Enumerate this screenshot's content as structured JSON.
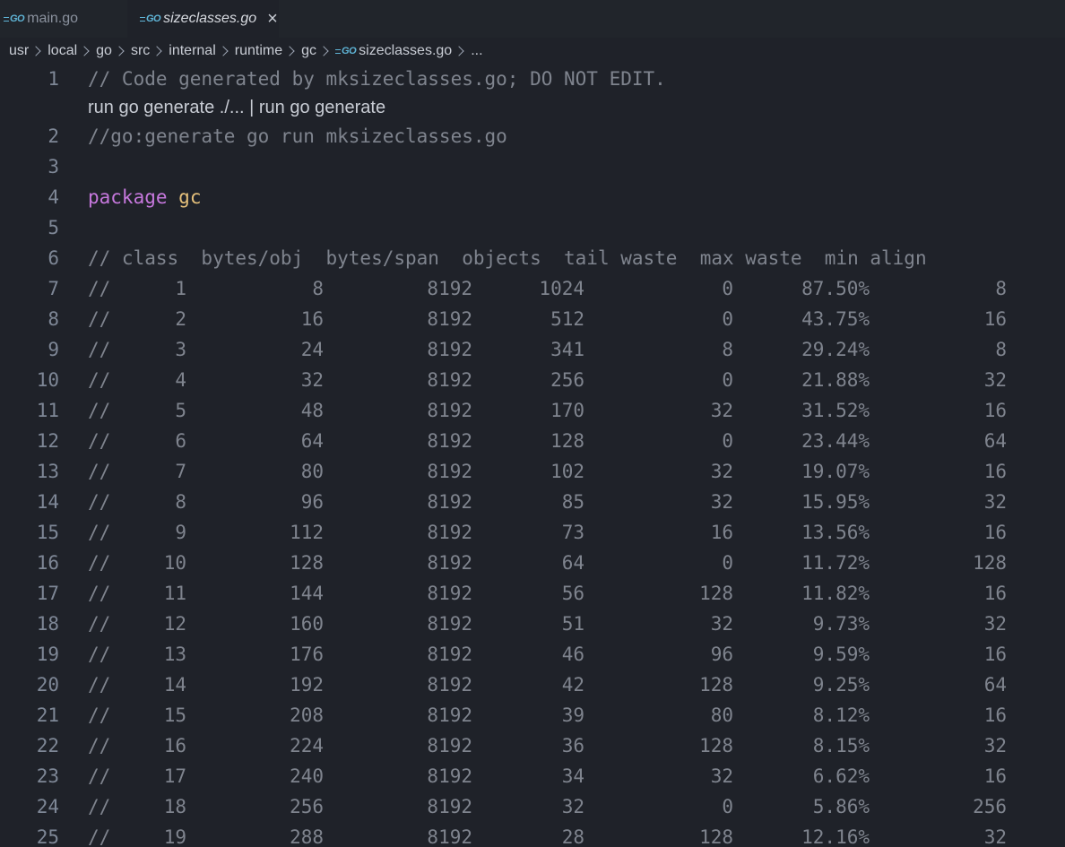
{
  "tabs": [
    {
      "name": "main.go",
      "logo": "GO",
      "active": false
    },
    {
      "name": "sizeclasses.go",
      "logo": "GO",
      "active": true
    }
  ],
  "breadcrumb": {
    "parts": [
      "usr",
      "local",
      "go",
      "src",
      "internal",
      "runtime",
      "gc"
    ],
    "file": "sizeclasses.go",
    "logo": "GO",
    "more": "..."
  },
  "editor": {
    "line1": {
      "num": "1",
      "text": "// Code generated by mksizeclasses.go; DO NOT EDIT."
    },
    "codelens": "run go generate ./... | run go generate",
    "line2": {
      "num": "2",
      "text": "//go:generate go run mksizeclasses.go"
    },
    "line3": {
      "num": "3"
    },
    "line4": {
      "num": "4",
      "keyword": "package",
      "name": "gc"
    },
    "line5": {
      "num": "5"
    },
    "line6": {
      "num": "6",
      "text": "// class  bytes/obj  bytes/span  objects  tail waste  max waste  min align"
    },
    "table_rows": [
      {
        "num": "7",
        "class": "1",
        "bytes_obj": "8",
        "bytes_span": "8192",
        "objects": "1024",
        "tail_waste": "0",
        "max_waste": "87.50%",
        "min_align": "8"
      },
      {
        "num": "8",
        "class": "2",
        "bytes_obj": "16",
        "bytes_span": "8192",
        "objects": "512",
        "tail_waste": "0",
        "max_waste": "43.75%",
        "min_align": "16"
      },
      {
        "num": "9",
        "class": "3",
        "bytes_obj": "24",
        "bytes_span": "8192",
        "objects": "341",
        "tail_waste": "8",
        "max_waste": "29.24%",
        "min_align": "8"
      },
      {
        "num": "10",
        "class": "4",
        "bytes_obj": "32",
        "bytes_span": "8192",
        "objects": "256",
        "tail_waste": "0",
        "max_waste": "21.88%",
        "min_align": "32"
      },
      {
        "num": "11",
        "class": "5",
        "bytes_obj": "48",
        "bytes_span": "8192",
        "objects": "170",
        "tail_waste": "32",
        "max_waste": "31.52%",
        "min_align": "16"
      },
      {
        "num": "12",
        "class": "6",
        "bytes_obj": "64",
        "bytes_span": "8192",
        "objects": "128",
        "tail_waste": "0",
        "max_waste": "23.44%",
        "min_align": "64"
      },
      {
        "num": "13",
        "class": "7",
        "bytes_obj": "80",
        "bytes_span": "8192",
        "objects": "102",
        "tail_waste": "32",
        "max_waste": "19.07%",
        "min_align": "16"
      },
      {
        "num": "14",
        "class": "8",
        "bytes_obj": "96",
        "bytes_span": "8192",
        "objects": "85",
        "tail_waste": "32",
        "max_waste": "15.95%",
        "min_align": "32"
      },
      {
        "num": "15",
        "class": "9",
        "bytes_obj": "112",
        "bytes_span": "8192",
        "objects": "73",
        "tail_waste": "16",
        "max_waste": "13.56%",
        "min_align": "16"
      },
      {
        "num": "16",
        "class": "10",
        "bytes_obj": "128",
        "bytes_span": "8192",
        "objects": "64",
        "tail_waste": "0",
        "max_waste": "11.72%",
        "min_align": "128"
      },
      {
        "num": "17",
        "class": "11",
        "bytes_obj": "144",
        "bytes_span": "8192",
        "objects": "56",
        "tail_waste": "128",
        "max_waste": "11.82%",
        "min_align": "16"
      },
      {
        "num": "18",
        "class": "12",
        "bytes_obj": "160",
        "bytes_span": "8192",
        "objects": "51",
        "tail_waste": "32",
        "max_waste": "9.73%",
        "min_align": "32"
      },
      {
        "num": "19",
        "class": "13",
        "bytes_obj": "176",
        "bytes_span": "8192",
        "objects": "46",
        "tail_waste": "96",
        "max_waste": "9.59%",
        "min_align": "16"
      },
      {
        "num": "20",
        "class": "14",
        "bytes_obj": "192",
        "bytes_span": "8192",
        "objects": "42",
        "tail_waste": "128",
        "max_waste": "9.25%",
        "min_align": "64"
      },
      {
        "num": "21",
        "class": "15",
        "bytes_obj": "208",
        "bytes_span": "8192",
        "objects": "39",
        "tail_waste": "80",
        "max_waste": "8.12%",
        "min_align": "16"
      },
      {
        "num": "22",
        "class": "16",
        "bytes_obj": "224",
        "bytes_span": "8192",
        "objects": "36",
        "tail_waste": "128",
        "max_waste": "8.15%",
        "min_align": "32"
      },
      {
        "num": "23",
        "class": "17",
        "bytes_obj": "240",
        "bytes_span": "8192",
        "objects": "34",
        "tail_waste": "32",
        "max_waste": "6.62%",
        "min_align": "16"
      },
      {
        "num": "24",
        "class": "18",
        "bytes_obj": "256",
        "bytes_span": "8192",
        "objects": "32",
        "tail_waste": "0",
        "max_waste": "5.86%",
        "min_align": "256"
      },
      {
        "num": "25",
        "class": "19",
        "bytes_obj": "288",
        "bytes_span": "8192",
        "objects": "28",
        "tail_waste": "128",
        "max_waste": "12.16%",
        "min_align": "32"
      }
    ]
  },
  "colors": {
    "background": "#1f2229",
    "tab_bar": "#21252b",
    "comment": "#7f848e",
    "keyword": "#c678dd",
    "package_name": "#e5c07b",
    "line_number": "#7e8796",
    "go_logo": "#5fb4d6"
  },
  "icons": {
    "close": "close-icon",
    "breadcrumb_separator": "chevron-right-icon",
    "file_type": "go-file-icon"
  }
}
